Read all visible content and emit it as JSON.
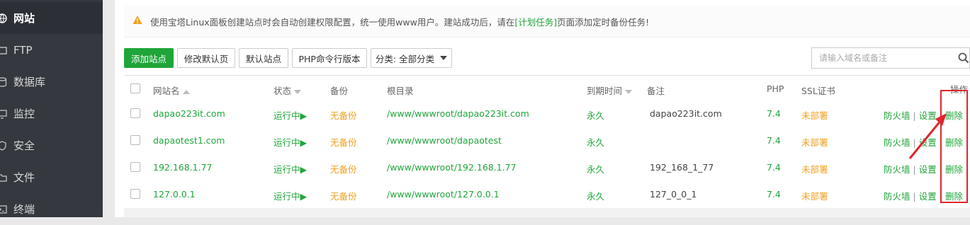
{
  "sidebar": {
    "items": [
      {
        "label": "网站",
        "icon": "globe-icon",
        "active": true
      },
      {
        "label": "FTP",
        "icon": "ftp-icon",
        "active": false
      },
      {
        "label": "数据库",
        "icon": "database-icon",
        "active": false
      },
      {
        "label": "监控",
        "icon": "monitor-icon",
        "active": false
      },
      {
        "label": "安全",
        "icon": "shield-icon",
        "active": false
      },
      {
        "label": "文件",
        "icon": "folder-icon",
        "active": false
      },
      {
        "label": "终端",
        "icon": "terminal-icon",
        "active": false
      }
    ]
  },
  "notice": {
    "text_before": "使用宝塔Linux面板创建站点时会自动创建权限配置，统一使用www用户。建站成功后，请在",
    "link": "[计划任务]",
    "text_after": "页面添加定时备份任务!"
  },
  "toolbar": {
    "add_site": "添加站点",
    "edit_default_page": "修改默认页",
    "default_site": "默认站点",
    "php_cli_version": "PHP命令行版本",
    "category": "分类: 全部分类"
  },
  "search": {
    "placeholder": "请输入域名或备注"
  },
  "table": {
    "headers": {
      "name": "网站名",
      "status": "状态",
      "backup": "备份",
      "root": "根目录",
      "expire": "到期时间",
      "remark": "备注",
      "php": "PHP",
      "ssl": "SSL证书",
      "ops": "操作"
    },
    "rows": [
      {
        "name": "dapao223it.com",
        "status": "运行中▶",
        "backup": "无备份",
        "root": "/www/wwwroot/dapao223it.com",
        "expire": "永久",
        "remark": "dapao223it.com",
        "php": "7.4",
        "ssl": "未部署"
      },
      {
        "name": "dapaotest1.com",
        "status": "运行中▶",
        "backup": "无备份",
        "root": "/www/wwwroot/dapaotest",
        "expire": "永久",
        "remark": "",
        "php": "7.4",
        "ssl": "未部署"
      },
      {
        "name": "192.168.1.77",
        "status": "运行中▶",
        "backup": "无备份",
        "root": "/www/wwwroot/192.168.1.77",
        "expire": "永久",
        "remark": "192_168_1_77",
        "php": "7.4",
        "ssl": "未部署"
      },
      {
        "name": "127.0.0.1",
        "status": "运行中▶",
        "backup": "无备份",
        "root": "/www/wwwroot/127.0.0.1",
        "expire": "永久",
        "remark": "127_0_0_1",
        "php": "7.4",
        "ssl": "未部署"
      }
    ],
    "actions": {
      "firewall": "防火墙",
      "settings": "设置",
      "delete": "删除"
    }
  },
  "colors": {
    "accent": "#20a53a",
    "warning": "#f0a020",
    "annotation": "#e0262c",
    "sidebar": "#35393f"
  }
}
